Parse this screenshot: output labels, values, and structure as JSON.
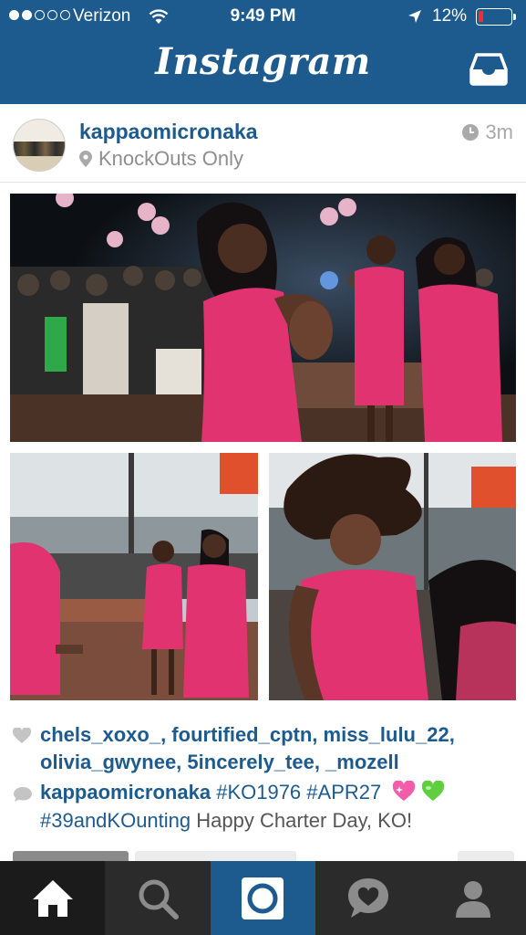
{
  "status_bar": {
    "carrier": "Verizon",
    "time": "9:49 PM",
    "battery_percent": "12%",
    "signal_bars_filled": 2,
    "signal_bars_total": 5,
    "battery_level": 0.12
  },
  "nav": {
    "logo": "Instagram",
    "inbox_icon": "inbox-tray-icon"
  },
  "post": {
    "username": "kappaomicronaka",
    "location": "KnockOuts Only",
    "time_ago": "3m",
    "likes": "chels_xoxo_, fourtified_cptn, miss_lulu_22, olivia_gwynee, 5incerely_tee, _mozell",
    "caption": {
      "user": "kappaomicronaka",
      "tags_line1": "#KO1976 #APR27",
      "tags_line2": "#39andKOunting",
      "text": "Happy Charter Day, KO!",
      "emojis": [
        "pink-sparkling-heart-emoji",
        "green-heart-emoji"
      ]
    }
  },
  "tabbar": {
    "items": [
      "home-icon",
      "search-icon",
      "camera-icon",
      "activity-heart-icon",
      "profile-icon"
    ],
    "active": "home-icon"
  },
  "colors": {
    "brand_blue": "#1d5b8f",
    "tab_bg": "#2b2b2b",
    "dress_pink": "#e0336f",
    "battery_low": "#ff2b2b"
  }
}
